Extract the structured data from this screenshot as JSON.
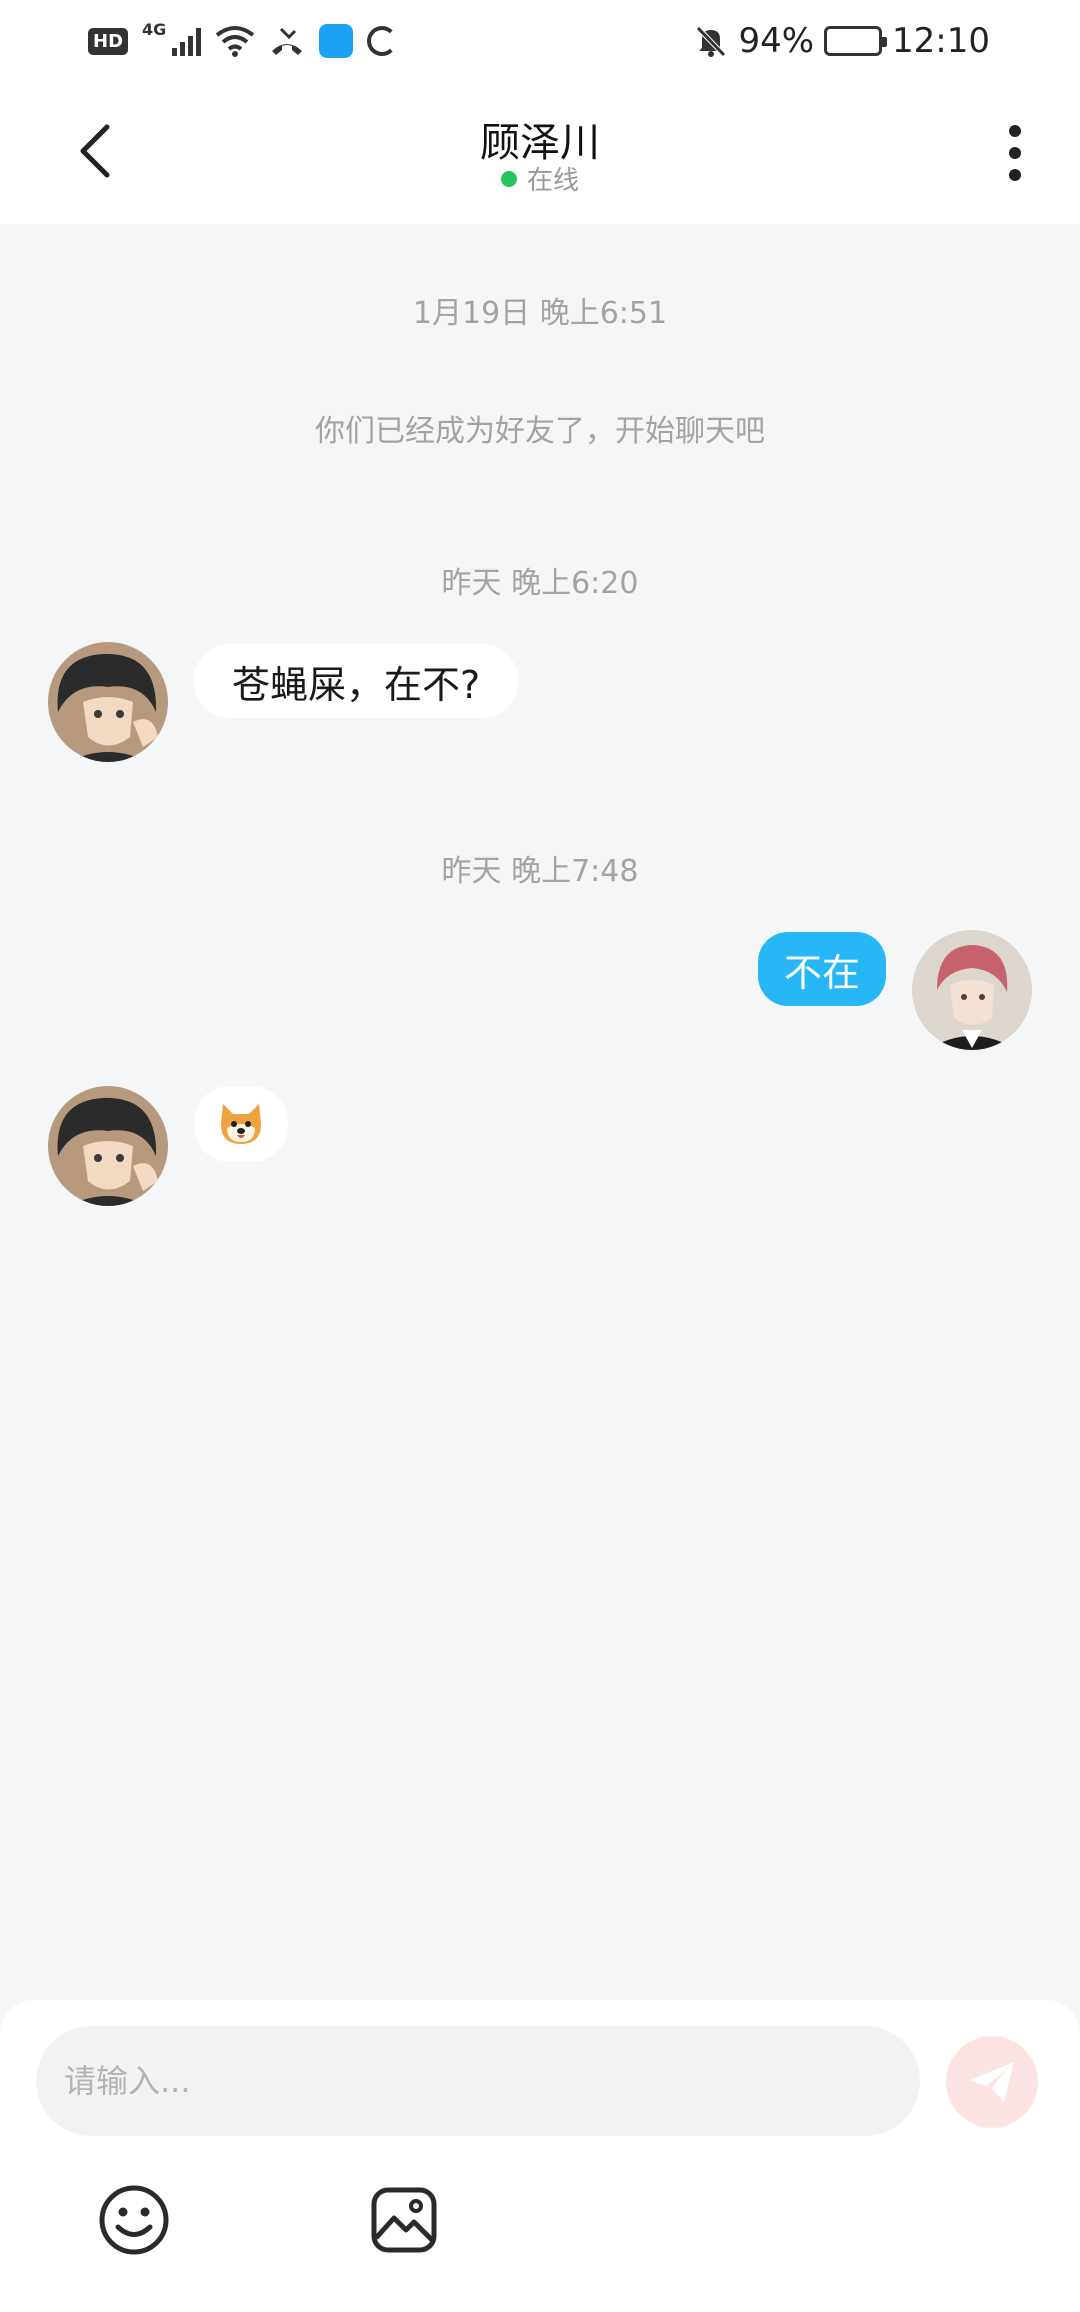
{
  "status_bar": {
    "hd": "HD",
    "network": "4G",
    "battery": "94%",
    "time": "12:10"
  },
  "header": {
    "title": "顾泽川",
    "status": "在线",
    "online_color": "#22c55e"
  },
  "chat": {
    "timestamps": [
      "1月19日 晚上6:51",
      "昨天 晚上6:20",
      "昨天 晚上7:48"
    ],
    "system_message": "你们已经成为好友了，开始聊天吧",
    "messages": [
      {
        "sender": "them",
        "type": "text",
        "text": "苍蝇屎，在不?"
      },
      {
        "sender": "me",
        "type": "text",
        "text": "不在"
      },
      {
        "sender": "them",
        "type": "emoji",
        "emoji": "🐶",
        "icon": "shiba-dog-emoji"
      }
    ]
  },
  "composer": {
    "placeholder": "请输入...",
    "send_icon": "send-icon",
    "tools": [
      "smiley-icon",
      "image-icon"
    ]
  },
  "colors": {
    "outgoing_bubble": "#27b6f6",
    "send_button": "#fde4e4"
  }
}
